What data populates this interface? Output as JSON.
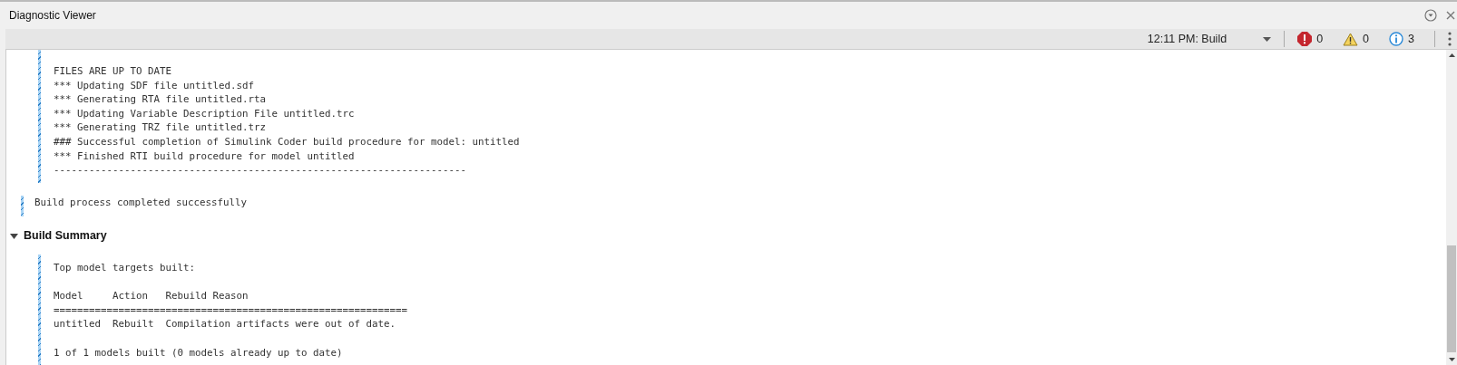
{
  "window": {
    "title": "Diagnostic Viewer"
  },
  "toolbar": {
    "session": "12:11 PM: Build",
    "errors": "0",
    "warnings": "0",
    "infos": "3"
  },
  "log": [
    {
      "kind": "nested",
      "groups": [
        [
          "FILES ARE UP TO DATE",
          "*** Updating SDF file untitled.sdf",
          "*** Generating RTA file untitled.rta",
          "*** Updating Variable Description File untitled.trc",
          "*** Generating TRZ file untitled.trz",
          "### Successful completion of Simulink Coder build procedure for model: untitled",
          "*** Finished RTI build procedure for model untitled",
          "----------------------------------------------------------------------"
        ]
      ]
    },
    {
      "kind": "top",
      "groups": [
        [
          "Build process completed successfully"
        ]
      ]
    },
    {
      "kind": "section",
      "title": "Build Summary",
      "expanded": true
    },
    {
      "kind": "nested",
      "groups": [
        [
          "Top model targets built:"
        ],
        [
          "Model     Action   Rebuild Reason",
          "============================================================",
          "untitled  Rebuilt  Compilation artifacts were out of date."
        ],
        [
          "1 of 1 models built (0 models already up to date)"
        ]
      ]
    }
  ]
}
